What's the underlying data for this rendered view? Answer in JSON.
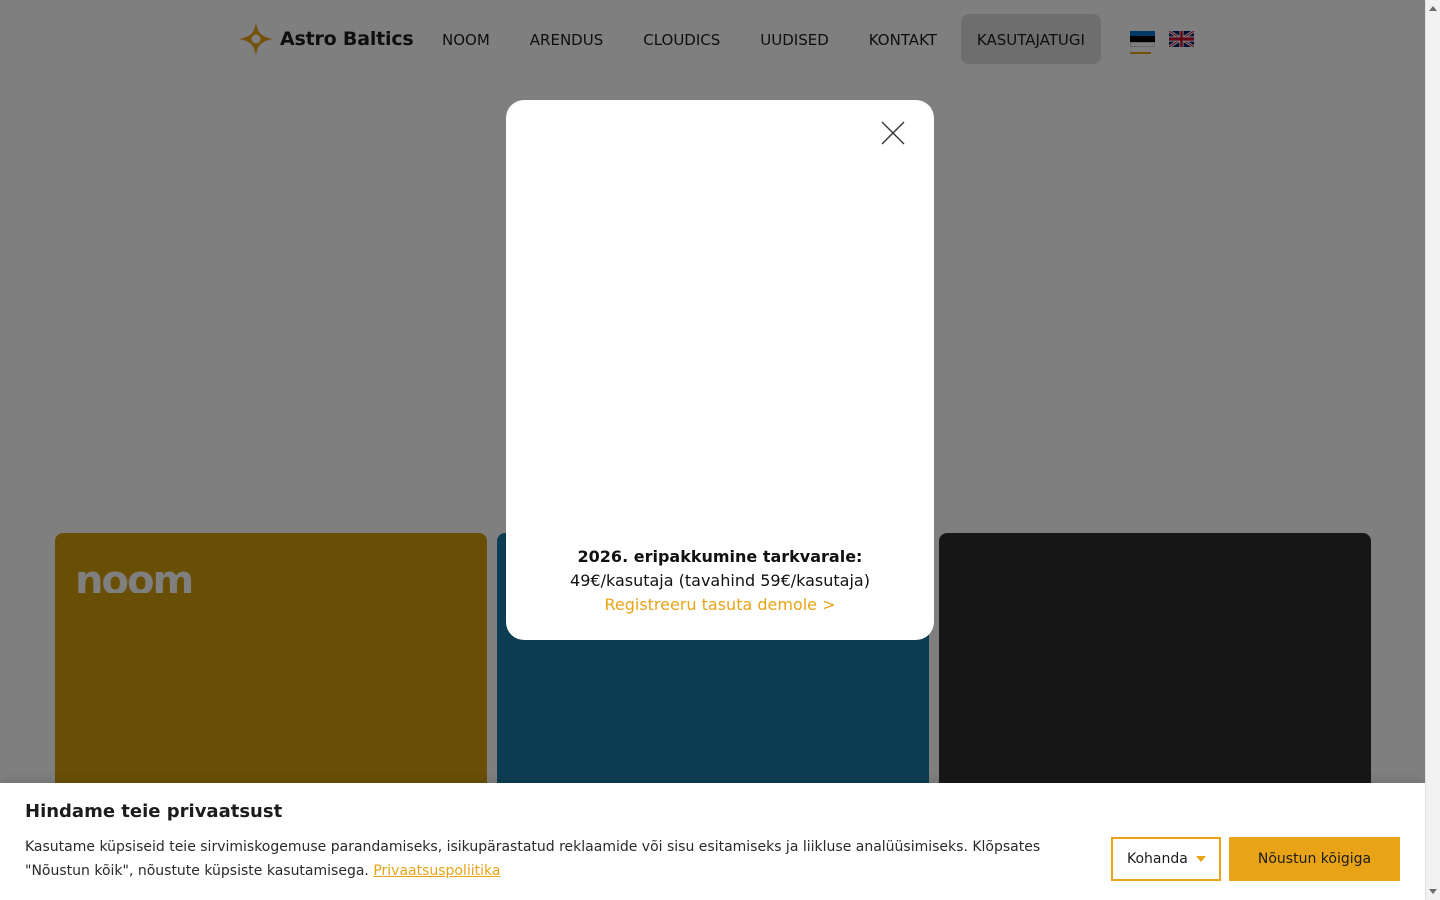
{
  "header": {
    "brand": "Astro Baltics",
    "nav": [
      "NOOM",
      "ARENDUS",
      "CLOUDICS",
      "UUDISED",
      "KONTAKT",
      "KASUTAJATUGI"
    ],
    "active_nav": "KASUTAJATUGI",
    "languages": [
      "Estonian flag",
      "English flag"
    ],
    "selected_language": "Estonian flag"
  },
  "cards": {
    "noom_logo": "noom",
    "colors": {
      "noom": "#d39d0d",
      "arendus": "#1a7ba7",
      "cloudics": "#2f2f2f"
    }
  },
  "modal": {
    "heading": "2026. eripakkumine tarkvarale:",
    "price_text": "49€/kasutaja (tavahind 59€/kasutaja)",
    "link_text": "Registreeru tasuta demole >",
    "close_icon": "close-icon"
  },
  "cookie": {
    "title": "Hindame teie privaatsust",
    "text": "Kasutame küpsiseid teie sirvimiskogemuse parandamiseks, isikupärastatud reklaamide või sisu esitamiseks ja liikluse analüüsimiseks. Klõpsates \"Nõustun kõik\", nõustute küpsiste kasutamisega.",
    "policy_link": "Privaatsuspoliitika",
    "customize_label": "Kohanda",
    "accept_label": "Nõustun kõigiga"
  },
  "colors": {
    "accent": "#e8a317",
    "overlay": "rgba(0,0,0,0.5)"
  }
}
